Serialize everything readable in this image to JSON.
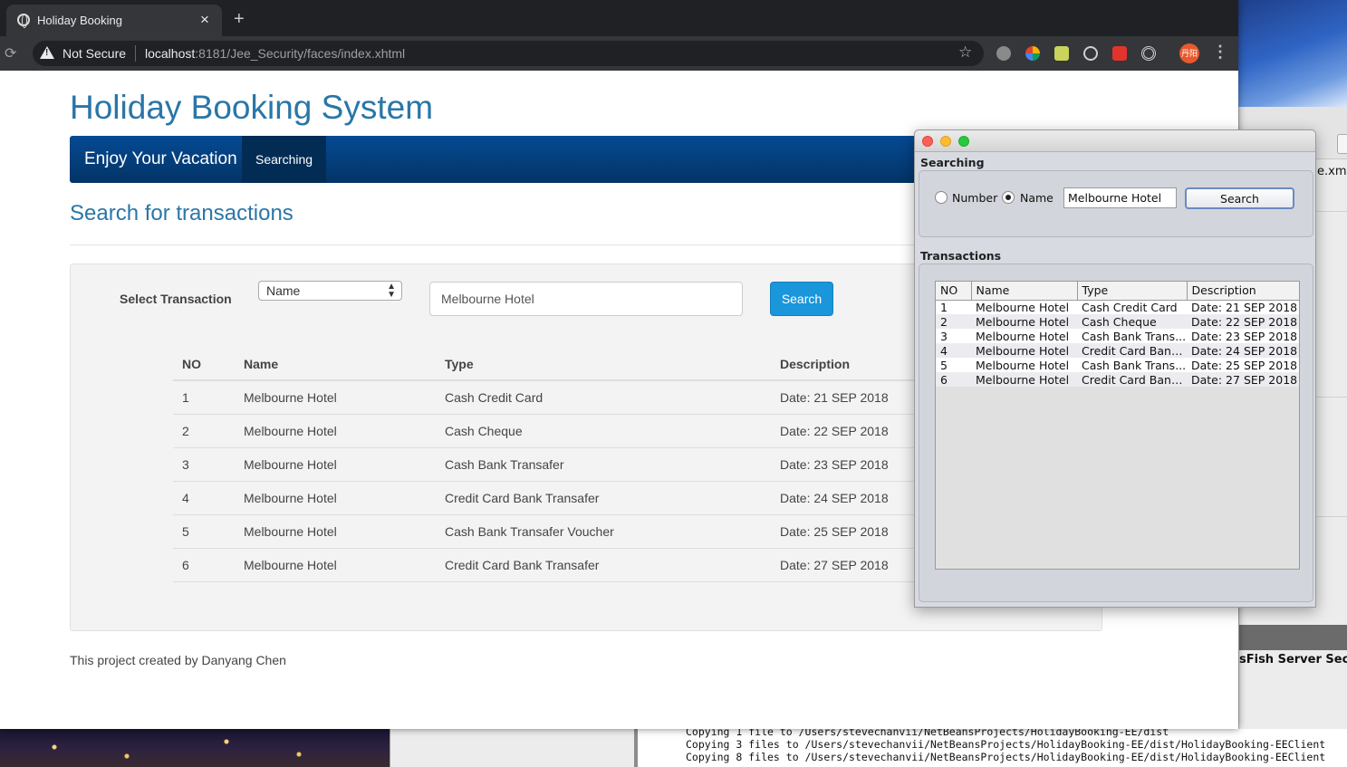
{
  "browser": {
    "tab_title": "Holiday Booking",
    "not_secure": "Not Secure",
    "url_host": "localhost",
    "url_rest": ":8181/Jee_Security/faces/index.xhtml",
    "extension_icons": [
      "abp-icon",
      "extension-icon",
      "extension-icon",
      "react-icon",
      "extension-s-icon",
      "target-icon",
      "profile-avatar"
    ],
    "profile_label": "丹阳"
  },
  "site": {
    "title": "Holiday Booking System",
    "brand": "Enjoy Your Vacation",
    "nav_active": "Searching",
    "section_title": "Search for transactions",
    "select_label": "Select Transaction",
    "select_value": "Name",
    "search_value": "Melbourne Hotel",
    "search_button": "Search",
    "footer": "This project created by Danyang Chen"
  },
  "web_table": {
    "headers": [
      "NO",
      "Name",
      "Type",
      "Description"
    ],
    "rows": [
      [
        "1",
        "Melbourne Hotel",
        "Cash Credit Card",
        "Date: 21 SEP 2018"
      ],
      [
        "2",
        "Melbourne Hotel",
        "Cash Cheque",
        "Date: 22 SEP 2018"
      ],
      [
        "3",
        "Melbourne Hotel",
        "Cash Bank Transafer",
        "Date: 23 SEP 2018"
      ],
      [
        "4",
        "Melbourne Hotel",
        "Credit Card Bank Transafer",
        "Date: 24 SEP 2018"
      ],
      [
        "5",
        "Melbourne Hotel",
        "Cash Bank Transafer Voucher",
        "Date: 25 SEP 2018"
      ],
      [
        "6",
        "Melbourne Hotel",
        "Credit Card Bank Transafer",
        "Date: 27 SEP 2018"
      ]
    ]
  },
  "swing": {
    "searching_label": "Searching",
    "radio_number": "Number",
    "radio_name": "Name",
    "input_value": "Melbourne Hotel",
    "search_button": "Search",
    "transactions_label": "Transactions",
    "headers": [
      "NO",
      "Name",
      "Type",
      "Description"
    ],
    "rows": [
      [
        "1",
        "Melbourne Hotel",
        "Cash Credit Card",
        "Date: 21 SEP 2018"
      ],
      [
        "2",
        "Melbourne Hotel",
        "Cash Cheque",
        "Date: 22 SEP 2018"
      ],
      [
        "3",
        "Melbourne Hotel",
        "Cash Bank Trans...",
        "Date: 23 SEP 2018"
      ],
      [
        "4",
        "Melbourne Hotel",
        "Credit Card Bank...",
        "Date: 24 SEP 2018"
      ],
      [
        "5",
        "Melbourne Hotel",
        "Cash Bank Trans...",
        "Date: 25 SEP 2018"
      ],
      [
        "6",
        "Melbourne Hotel",
        "Credit Card Bank...",
        "Date: 27 SEP 2018"
      ]
    ]
  },
  "background": {
    "right_xml": "e.xml",
    "right_server": "sFish Server Secur",
    "console": [
      "Copying 1 file to /Users/stevechanvii/NetBeansProjects/HolidayBooking-EE/dist",
      "Copying 3 files to /Users/stevechanvii/NetBeansProjects/HolidayBooking-EE/dist/HolidayBooking-EEClient",
      "Copying 8 files to /Users/stevechanvii/NetBeansProjects/HolidayBooking-EE/dist/HolidayBooking-EEClient"
    ]
  },
  "colors": {
    "site_blue": "#2a76a8",
    "navbar": "#054a93",
    "button_blue": "#1a96db"
  }
}
